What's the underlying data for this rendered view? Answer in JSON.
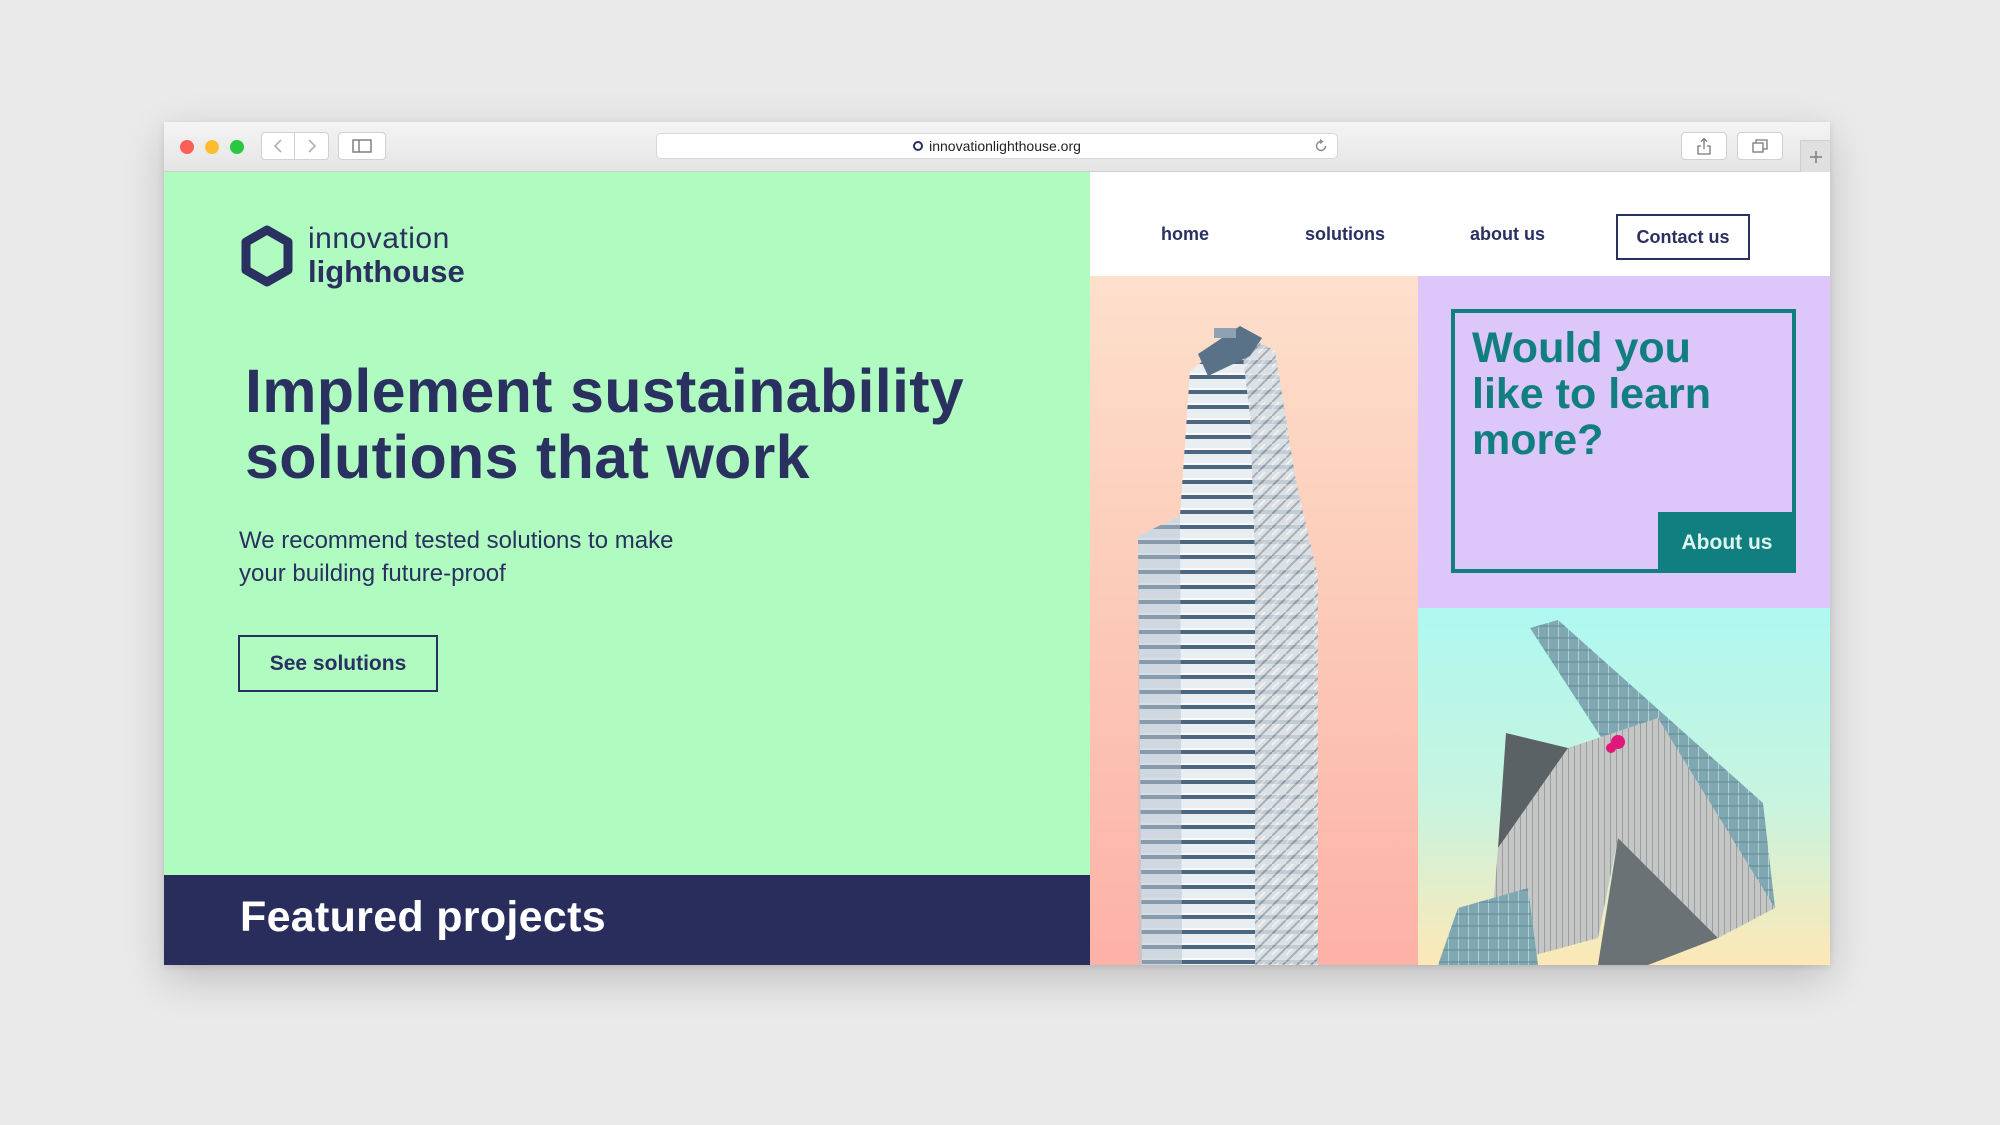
{
  "browser": {
    "url": "innovationlighthouse.org"
  },
  "logo": {
    "line1": "innovation",
    "line2": "lighthouse"
  },
  "nav": {
    "home": "home",
    "solutions": "solutions",
    "about": "about us",
    "contact": "Contact us"
  },
  "hero": {
    "headline_line1": "Implement sustainability",
    "headline_line2": "solutions that work",
    "subtext_line1": "We recommend tested solutions to make",
    "subtext_line2": "your building future-proof",
    "cta": "See solutions"
  },
  "learn": {
    "line1": "Would you",
    "line2": "like to learn",
    "line3": "more?",
    "button": "About us"
  },
  "featured": {
    "title": "Featured projects"
  },
  "colors": {
    "navy": "#2a3060",
    "mint": "#b0fbc0",
    "teal": "#117e80",
    "lavender": "#dcc6fa",
    "featured_bg": "#282d5c"
  }
}
